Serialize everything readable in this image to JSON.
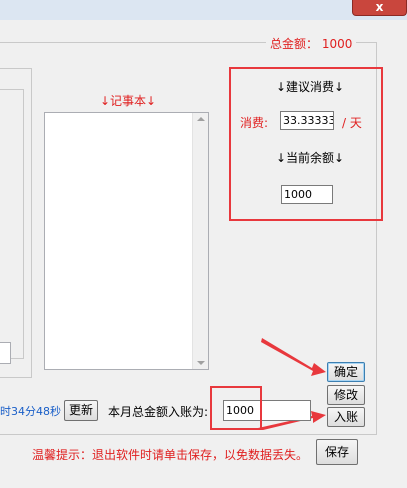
{
  "header": {
    "total_label": "总金额：  1000",
    "close_symbol": "x"
  },
  "notes": {
    "title": "↓记事本↓",
    "content": ""
  },
  "suggestion": {
    "title": "↓建议消费↓",
    "consume_label": "消费:",
    "consume_value": "33.333333",
    "per_day": "/ 天",
    "balance_title": "↓当前余额↓",
    "balance_value": "1000"
  },
  "buttons": {
    "confirm": "确定",
    "modify": "修改",
    "deposit": "入账",
    "update": "更新",
    "save": "保存"
  },
  "footer": {
    "time_text": "时34分48秒",
    "month_label": "本月总金额入账为:",
    "month_value": "1000",
    "tip": "温馨提示：退出软件时请单击保存，以免数据丢失。"
  },
  "colors": {
    "accent_red": "#e02020",
    "highlight": "#e8383d",
    "time_blue": "#1a5fc8"
  }
}
